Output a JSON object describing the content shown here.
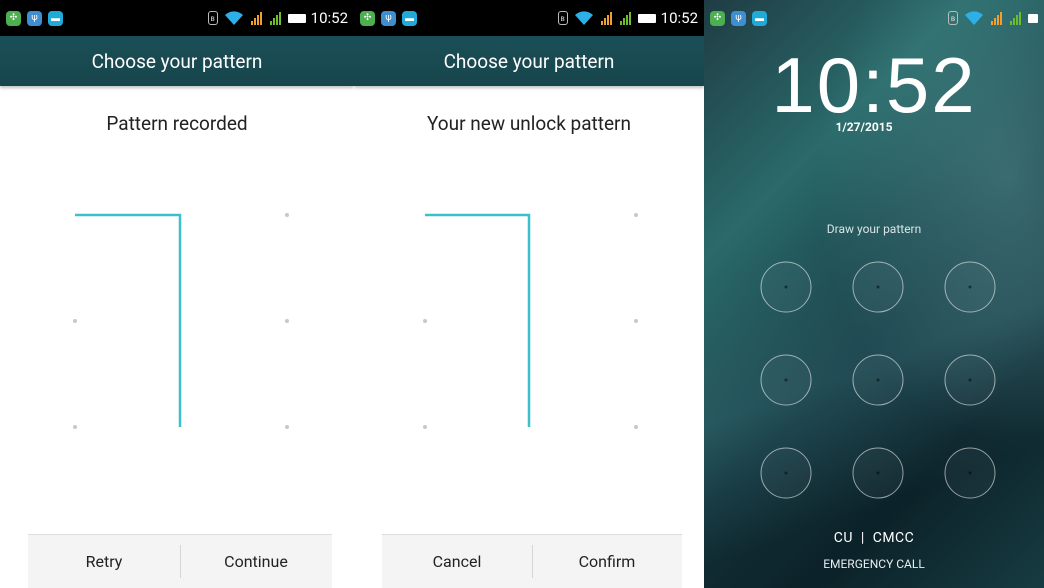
{
  "status_bar": {
    "time": "10:52",
    "apps": [
      {
        "icon": "app-icon-green",
        "color": "#4caf50"
      },
      {
        "icon": "usb-icon",
        "color": "#3f8fd0"
      },
      {
        "icon": "chat-icon",
        "color": "#1faad8"
      }
    ],
    "colors": {
      "signal1": "#f0a030",
      "signal2": "#6cbf2a",
      "wifi": "#2db0e8"
    }
  },
  "screens": [
    {
      "title": "Choose your pattern",
      "instruction": "Pattern recorded",
      "buttons": [
        "Retry",
        "Continue"
      ]
    },
    {
      "title": "Choose your pattern",
      "instruction": "Your new unlock pattern",
      "buttons": [
        "Cancel",
        "Confirm"
      ]
    }
  ],
  "lockscreen": {
    "time": "10:52",
    "date": "1/27/2015",
    "hint": "Draw your pattern",
    "carrier": "CU  |  CMCC",
    "emergency": "EMERGENCY CALL"
  },
  "colors": {
    "accent": "#1b4f57",
    "pattern_line": "#3ec0cc",
    "dot": "#c8c8c8"
  }
}
